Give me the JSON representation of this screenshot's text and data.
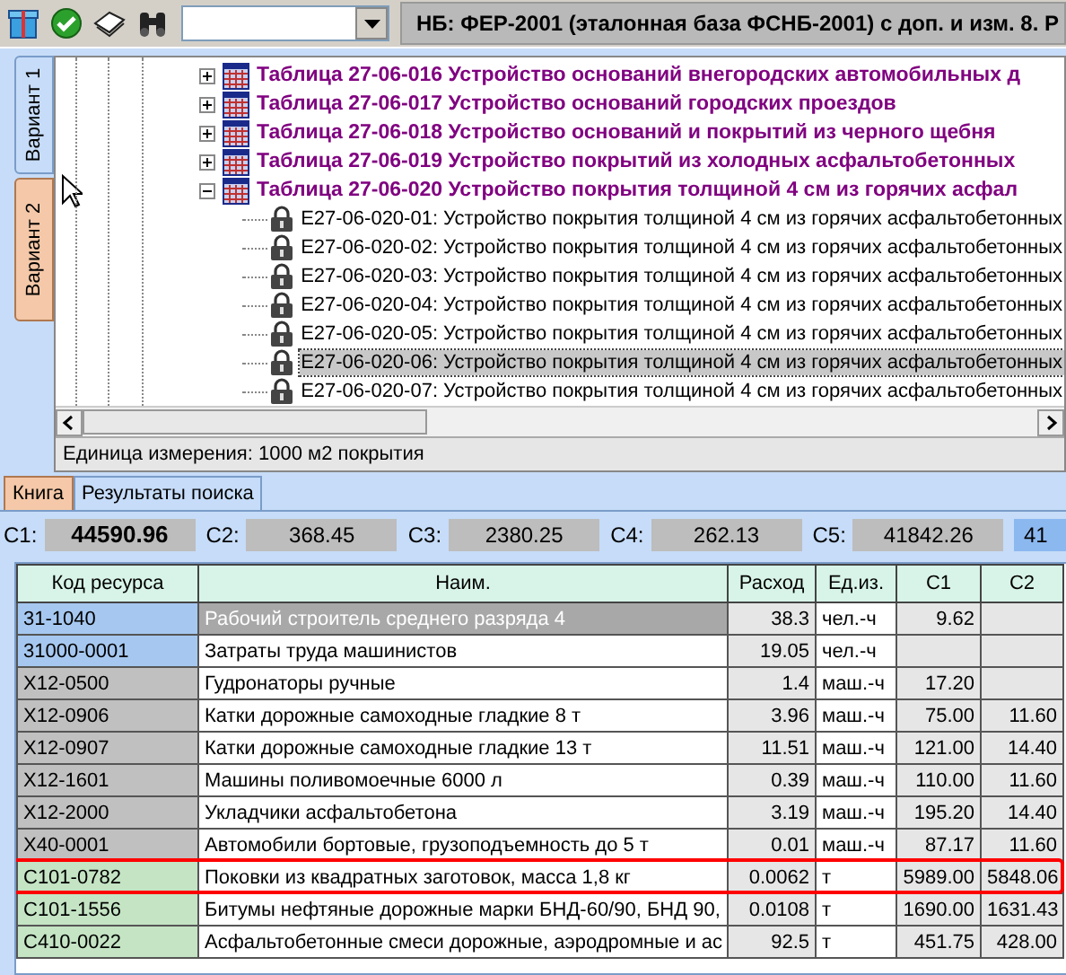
{
  "toolbar": {
    "database_title": "НБ: ФЕР-2001 (эталонная база ФСНБ-2001) с доп. и изм. 8. Р"
  },
  "side_tabs": [
    {
      "label": "Вариант 1",
      "selected": false
    },
    {
      "label": "Вариант 2",
      "selected": true
    }
  ],
  "tree": [
    {
      "label": "Таблица 27-06-016 Устройство оснований внегородских автомобильных д",
      "expanded": false
    },
    {
      "label": "Таблица 27-06-017 Устройство оснований городских проездов",
      "expanded": false
    },
    {
      "label": "Таблица 27-06-018 Устройство оснований и покрытий из черного щебня",
      "expanded": false
    },
    {
      "label": "Таблица 27-06-019 Устройство покрытий из холодных асфальтобетонных",
      "expanded": false
    },
    {
      "label": "Таблица 27-06-020 Устройство покрытия толщиной 4 см из горячих асфал",
      "expanded": true,
      "children": [
        {
          "label": "E27-06-020-01: Устройство покрытия толщиной 4 см из горячих асфальтобетонных",
          "selected": false
        },
        {
          "label": "E27-06-020-02: Устройство покрытия толщиной 4 см из горячих асфальтобетонных",
          "selected": false
        },
        {
          "label": "E27-06-020-03: Устройство покрытия толщиной 4 см из горячих асфальтобетонных",
          "selected": false
        },
        {
          "label": "E27-06-020-04: Устройство покрытия толщиной 4 см из горячих асфальтобетонных",
          "selected": false
        },
        {
          "label": "E27-06-020-05: Устройство покрытия толщиной 4 см из горячих асфальтобетонных",
          "selected": false
        },
        {
          "label": "E27-06-020-06: Устройство покрытия толщиной 4 см из горячих асфальтобетонных",
          "selected": true
        },
        {
          "label": "E27-06-020-07: Устройство покрытия толщиной 4 см из горячих асфальтобетонных",
          "selected": false
        }
      ]
    }
  ],
  "unit_line": "Единица измерения: 1000 м2 покрытия",
  "tabs": [
    {
      "label": "Книга",
      "selected": true
    },
    {
      "label": "Результаты поиска",
      "selected": false
    }
  ],
  "totals": [
    {
      "label": "C1:",
      "value": "44590.96",
      "bold": true
    },
    {
      "label": "C2:",
      "value": "368.45",
      "bold": false
    },
    {
      "label": "C3:",
      "value": "2380.25",
      "bold": false
    },
    {
      "label": "C4:",
      "value": "262.13",
      "bold": false
    },
    {
      "label": "C5:",
      "value": "41842.26",
      "bold": false
    },
    {
      "value": "41",
      "bold": false
    }
  ],
  "table": {
    "columns": [
      "Код ресурса",
      "Наим.",
      "Расход",
      "Ед.из.",
      "C1",
      "C2"
    ],
    "rows": [
      {
        "kind": "labor",
        "selected": true,
        "highlighted": false,
        "cells": [
          "31-1040",
          "Рабочий строитель среднего разряда 4",
          "38.3",
          "чел.-ч",
          "9.62",
          ""
        ]
      },
      {
        "kind": "labor",
        "selected": false,
        "highlighted": false,
        "cells": [
          "31000-0001",
          "Затраты труда машинистов",
          "19.05",
          "чел.-ч",
          "",
          ""
        ]
      },
      {
        "kind": "machine",
        "selected": false,
        "highlighted": false,
        "cells": [
          "X12-0500",
          "Гудронаторы ручные",
          "1.4",
          "маш.-ч",
          "17.20",
          ""
        ]
      },
      {
        "kind": "machine",
        "selected": false,
        "highlighted": false,
        "cells": [
          "X12-0906",
          "Катки дорожные самоходные гладкие 8 т",
          "3.96",
          "маш.-ч",
          "75.00",
          "11.60"
        ]
      },
      {
        "kind": "machine",
        "selected": false,
        "highlighted": false,
        "cells": [
          "X12-0907",
          "Катки дорожные самоходные гладкие 13 т",
          "11.51",
          "маш.-ч",
          "121.00",
          "14.40"
        ]
      },
      {
        "kind": "machine",
        "selected": false,
        "highlighted": false,
        "cells": [
          "X12-1601",
          "Машины поливомоечные 6000 л",
          "0.39",
          "маш.-ч",
          "110.00",
          "11.60"
        ]
      },
      {
        "kind": "machine",
        "selected": false,
        "highlighted": false,
        "cells": [
          "X12-2000",
          "Укладчики асфальтобетона",
          "3.19",
          "маш.-ч",
          "195.20",
          "14.40"
        ]
      },
      {
        "kind": "machine",
        "selected": false,
        "highlighted": false,
        "cells": [
          "X40-0001",
          "Автомобили бортовые, грузоподъемность до 5 т",
          "0.01",
          "маш.-ч",
          "87.17",
          "11.60"
        ]
      },
      {
        "kind": "material",
        "selected": false,
        "highlighted": true,
        "cells": [
          "C101-0782",
          "Поковки из квадратных заготовок, масса 1,8 кг",
          "0.0062",
          "т",
          "5989.00",
          "5848.06"
        ]
      },
      {
        "kind": "material",
        "selected": false,
        "highlighted": false,
        "cells": [
          "C101-1556",
          "Битумы нефтяные дорожные марки БНД-60/90, БНД 90,",
          "0.0108",
          "т",
          "1690.00",
          "1631.43"
        ]
      },
      {
        "kind": "material",
        "selected": false,
        "highlighted": false,
        "cells": [
          "C410-0022",
          "Асфальтобетонные смеси дорожные, аэродромные и ас",
          "92.5",
          "т",
          "451.75",
          "428.00"
        ]
      }
    ]
  }
}
